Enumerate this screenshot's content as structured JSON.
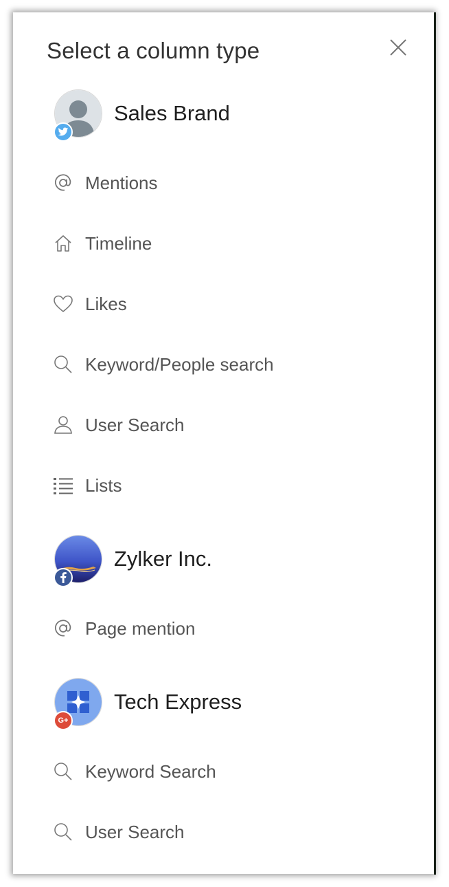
{
  "dialog": {
    "title": "Select a column type",
    "close_label": "Close"
  },
  "sections": [
    {
      "account": {
        "name": "Sales Brand",
        "network": "twitter",
        "avatar": "default-person-avatar"
      },
      "items": [
        {
          "label": "Mentions",
          "icon": "at-icon"
        },
        {
          "label": "Timeline",
          "icon": "home-icon"
        },
        {
          "label": "Likes",
          "icon": "heart-icon"
        },
        {
          "label": "Keyword/People search",
          "icon": "search-icon"
        },
        {
          "label": "User Search",
          "icon": "user-icon"
        },
        {
          "label": "Lists",
          "icon": "list-icon"
        }
      ]
    },
    {
      "account": {
        "name": "Zylker Inc.",
        "network": "facebook",
        "avatar": "landscape-avatar"
      },
      "items": [
        {
          "label": "Page mention",
          "icon": "at-icon"
        }
      ]
    },
    {
      "account": {
        "name": "Tech Express",
        "network": "google-plus",
        "avatar": "logo-avatar",
        "badge_text": "G+"
      },
      "items": [
        {
          "label": "Keyword Search",
          "icon": "search-icon"
        },
        {
          "label": "User Search",
          "icon": "search-icon"
        }
      ]
    }
  ],
  "colors": {
    "twitter": "#55acee",
    "facebook": "#3b5998",
    "google_plus": "#dd4b39",
    "label": "#555555",
    "title": "#333333"
  }
}
